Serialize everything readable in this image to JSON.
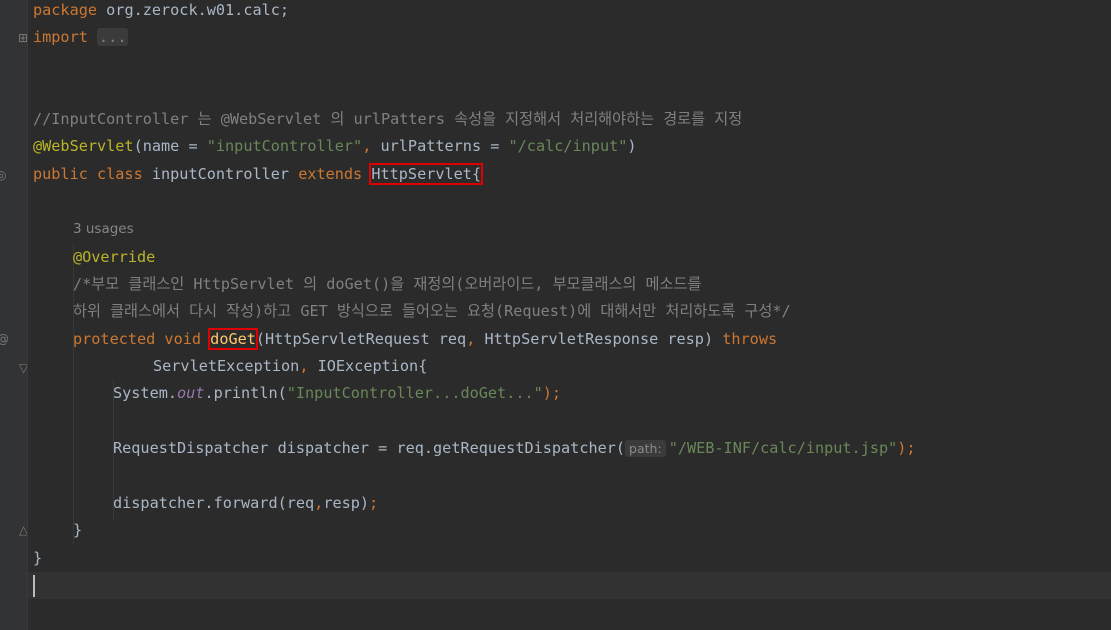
{
  "code": {
    "package_kw": "package",
    "package_name": " org.zerock.w01.calc;",
    "import_kw": "import",
    "import_fold": "...",
    "comment1": "//InputController 는 @WebServlet 의 urlPatters 속성을 지정해서 처리해야하는 경로를 지정",
    "webservlet_ann": "@WebServlet",
    "ws_open": "(name = ",
    "ws_name_val": "\"inputController\"",
    "ws_comma": ",",
    "ws_url_key": " urlPatterns = ",
    "ws_url_val": "\"/calc/input\"",
    "ws_close": ")",
    "class_kw": "public class",
    "class_name": " inputController ",
    "extends_kw": "extends",
    "superclass": "HttpServlet{",
    "usages": "3 usages",
    "override_ann": "@Override",
    "comment2": "/*부모 클래스인 HttpServlet 의 doGet()을 재정의(오버라이드, 부모클래스의 메소드를",
    "comment3": "하위 클래스에서 다시 작성)하고 GET 방식으로 들어오는 요청(Request)에 대해서만 처리하도록 구성*/",
    "protected_kw": "protected void",
    "method_name": "doGet",
    "params_a": "(HttpServletRequest req",
    "params_comma": ",",
    "params_b": " HttpServletResponse resp) ",
    "throws_kw": "throws",
    "exceptions_a": "ServletException",
    "exceptions_comma": ",",
    "exceptions_b": " IOException{",
    "sys_a": "System.",
    "sys_out": "out",
    "sys_b": ".println(",
    "sys_str": "\"InputController...doGet...\"",
    "sys_c": ");",
    "rd_a": "RequestDispatcher dispatcher = req.getRequestDispatcher(",
    "rd_hint": "path:",
    "rd_str": "\"/WEB-INF/calc/input.jsp\"",
    "rd_b": ");",
    "fwd_a": "dispatcher.forward(req",
    "fwd_comma": ",",
    "fwd_b": "resp)",
    "fwd_semi": ";",
    "close_method": "}",
    "close_class": "}"
  },
  "colors": {
    "background": "#2b2b2b",
    "keyword": "#cc7832",
    "string": "#6a8759",
    "annotation": "#bbb529",
    "comment": "#808080",
    "method": "#ffc66d",
    "highlight_box": "#e00000"
  },
  "gutter_icons": [
    "fold-icon",
    "servlet-class-icon",
    "override-method-icon",
    "fold-icon",
    "fold-end-icon"
  ]
}
